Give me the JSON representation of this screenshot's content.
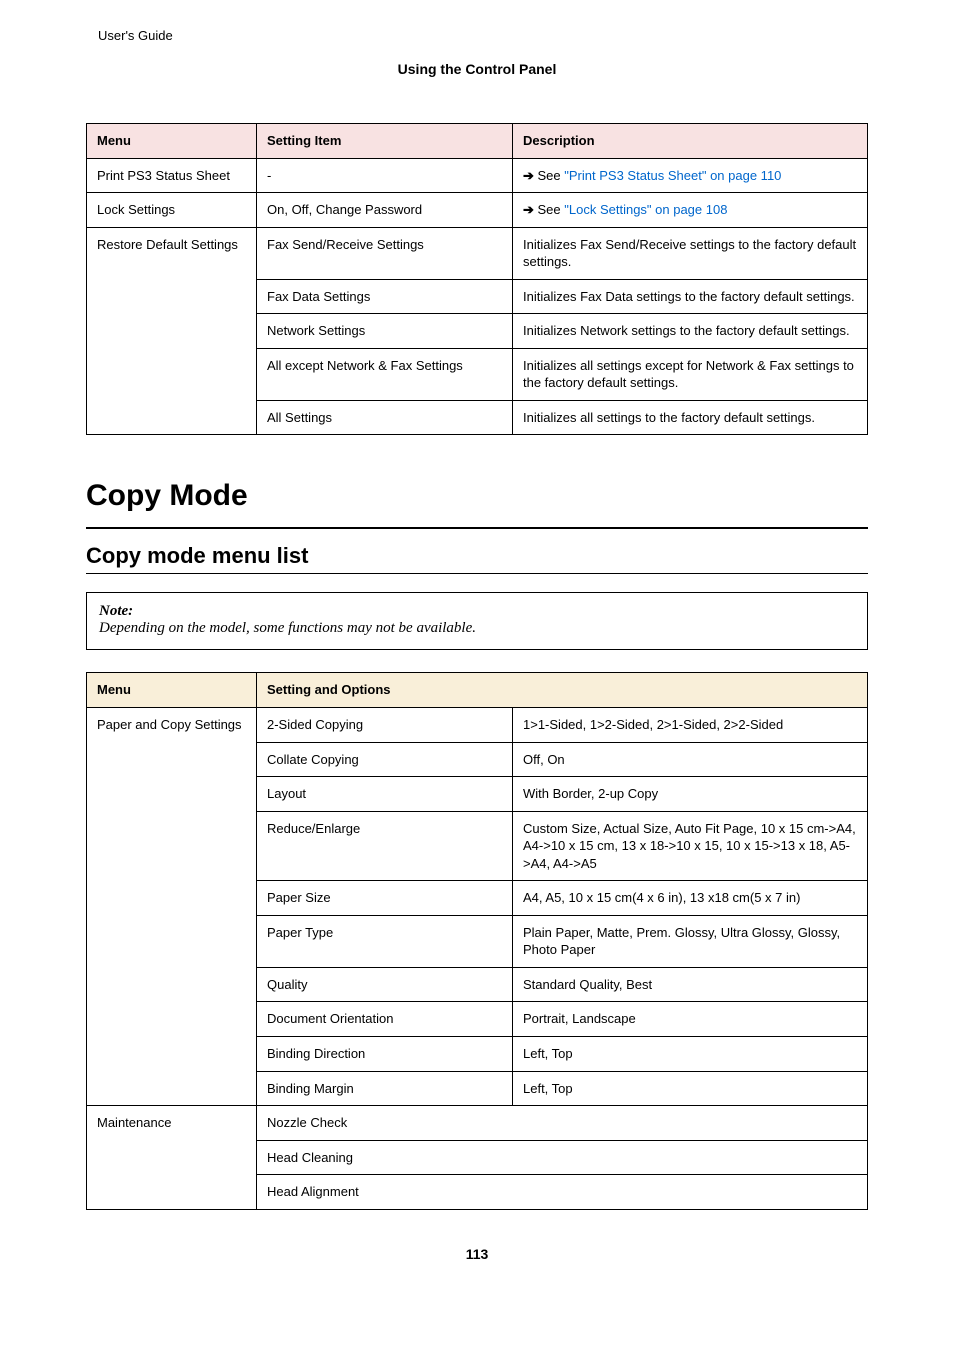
{
  "running_head": "User's Guide",
  "section_label": "Using the Control Panel",
  "table1": {
    "headers": {
      "menu": "Menu",
      "setting": "Setting Item",
      "desc": "Description"
    },
    "rows": {
      "ps3_menu": "Print PS3 Status Sheet",
      "ps3_setting": "-",
      "ps3_see": "See ",
      "ps3_link": "\"Print PS3 Status Sheet\" on page 110",
      "lock_menu": "Lock Settings",
      "lock_setting": "On, Off, Change Password",
      "lock_see": "See ",
      "lock_link": "\"Lock Settings\" on page 108",
      "restore_menu": "Restore Default Settings",
      "restore_rows": [
        {
          "setting": "Fax Send/Receive Settings",
          "desc": "Initializes Fax Send/Receive settings to the factory default settings."
        },
        {
          "setting": "Fax Data Settings",
          "desc": "Initializes Fax Data settings to the factory default settings."
        },
        {
          "setting": "Network Settings",
          "desc": "Initializes Network settings to the factory default settings."
        },
        {
          "setting": "All except Network & Fax Settings",
          "desc": "Initializes all settings except for Network & Fax settings to the factory default settings."
        },
        {
          "setting": "All Settings",
          "desc": "Initializes all settings to the factory default settings."
        }
      ]
    }
  },
  "h1": "Copy Mode",
  "h2": "Copy mode menu list",
  "note": {
    "title": "Note:",
    "body": "Depending on the model, some functions may not be available."
  },
  "table2": {
    "headers": {
      "menu": "Menu",
      "setting": "Setting and Options"
    },
    "paper_menu": "Paper and Copy Settings",
    "paper_rows": [
      {
        "setting": "2-Sided Copying",
        "opts": "1>1-Sided, 1>2-Sided, 2>1-Sided, 2>2-Sided"
      },
      {
        "setting": "Collate Copying",
        "opts": "Off, On"
      },
      {
        "setting": "Layout",
        "opts": "With Border, 2-up Copy"
      },
      {
        "setting": "Reduce/Enlarge",
        "opts": "Custom Size, Actual Size, Auto Fit Page, 10 x 15 cm->A4, A4->10 x 15 cm, 13 x 18->10 x 15, 10 x 15->13 x 18, A5->A4, A4->A5"
      },
      {
        "setting": "Paper Size",
        "opts": "A4, A5, 10 x 15 cm(4 x 6 in), 13 x18 cm(5 x 7 in)"
      },
      {
        "setting": "Paper Type",
        "opts": "Plain Paper, Matte, Prem. Glossy, Ultra Glossy, Glossy, Photo Paper"
      },
      {
        "setting": "Quality",
        "opts": "Standard Quality, Best"
      },
      {
        "setting": "Document Orientation",
        "opts": "Portrait, Landscape"
      },
      {
        "setting": "Binding Direction",
        "opts": "Left, Top"
      },
      {
        "setting": "Binding Margin",
        "opts": "Left, Top"
      }
    ],
    "maint_menu": "Maintenance",
    "maint_rows": [
      {
        "setting": "Nozzle Check"
      },
      {
        "setting": "Head Cleaning"
      },
      {
        "setting": "Head Alignment"
      }
    ]
  },
  "page_number": "113"
}
